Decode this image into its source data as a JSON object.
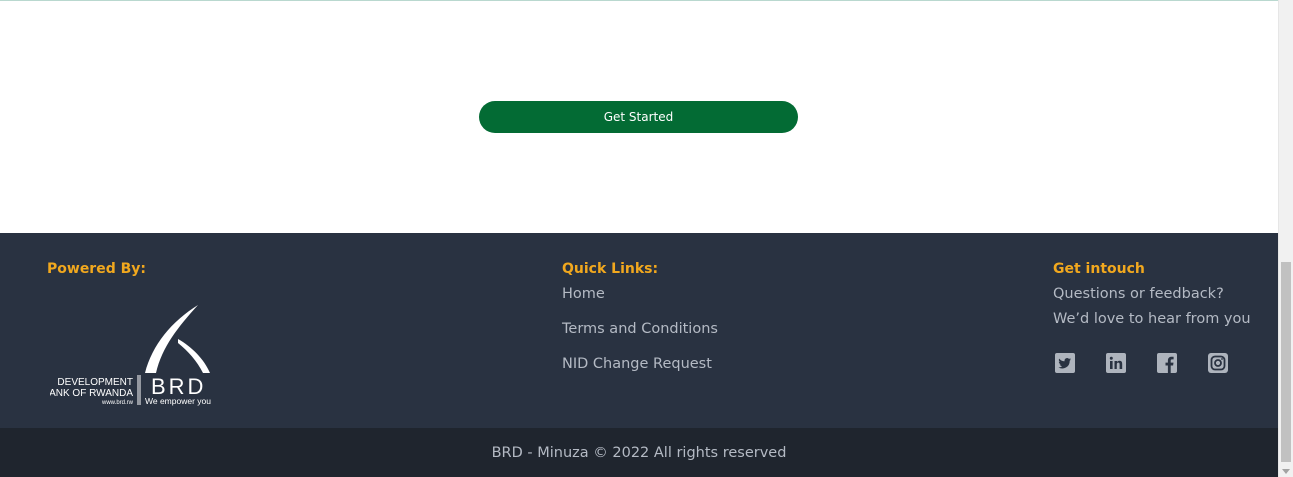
{
  "hero": {
    "cta_label": "Get Started"
  },
  "footer": {
    "powered_by": {
      "heading": "Powered By:",
      "logo": {
        "name_line1": "DEVELOPMENT",
        "name_line2": "BANK OF RWANDA",
        "website": "www.brd.rw",
        "mark": "BRD",
        "tagline": "We empower you"
      }
    },
    "quick_links": {
      "heading": "Quick Links:",
      "items": [
        {
          "label": "Home"
        },
        {
          "label": "Terms and Conditions"
        },
        {
          "label": "NID Change Request"
        }
      ]
    },
    "get_in_touch": {
      "heading": "Get intouch",
      "line1": "Questions or feedback?",
      "line2": "We’d love to hear from you",
      "social": [
        "twitter-icon",
        "linkedin-icon",
        "facebook-icon",
        "instagram-icon"
      ]
    },
    "copyright": "BRD - Minuza © 2022 All rights reserved"
  },
  "colors": {
    "brand_green": "#036b34",
    "footer_bg": "#293241",
    "footer_bottom_bg": "#1f252e",
    "accent": "#f1a81e",
    "footer_text": "#b4bac4"
  }
}
